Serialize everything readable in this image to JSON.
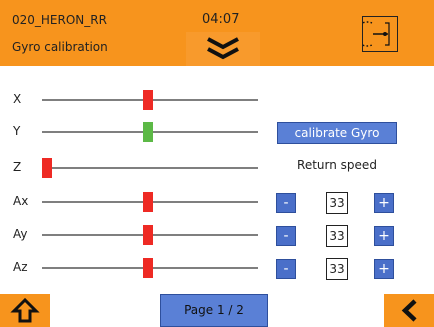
{
  "header": {
    "device_name": "020_HERON_RR",
    "time": "04:07",
    "page_title": "Gyro calibration"
  },
  "colors": {
    "accent": "#f7941d",
    "button_blue": "#5a80d6",
    "knob_red": "#ee2a24",
    "knob_green": "#5cb946"
  },
  "axes": [
    {
      "label": "X",
      "level": 0.49,
      "color": "red"
    },
    {
      "label": "Y",
      "level": 0.49,
      "color": "green"
    },
    {
      "label": "Z",
      "level": 0.0,
      "color": "red"
    },
    {
      "label": "Ax",
      "level": 0.49,
      "color": "red"
    },
    {
      "label": "Ay",
      "level": 0.49,
      "color": "red"
    },
    {
      "label": "Az",
      "level": 0.49,
      "color": "red"
    }
  ],
  "calibrate_button": "calibrate Gyro",
  "return_speed": {
    "label": "Return speed",
    "rows": [
      {
        "minus": "-",
        "value": "33",
        "plus": "+"
      },
      {
        "minus": "-",
        "value": "33",
        "plus": "+"
      },
      {
        "minus": "-",
        "value": "33",
        "plus": "+"
      }
    ]
  },
  "footer": {
    "page_label": "Page 1 / 2",
    "home_icon": "home-up-arrow-icon",
    "back_icon": "chevron-left-icon"
  }
}
